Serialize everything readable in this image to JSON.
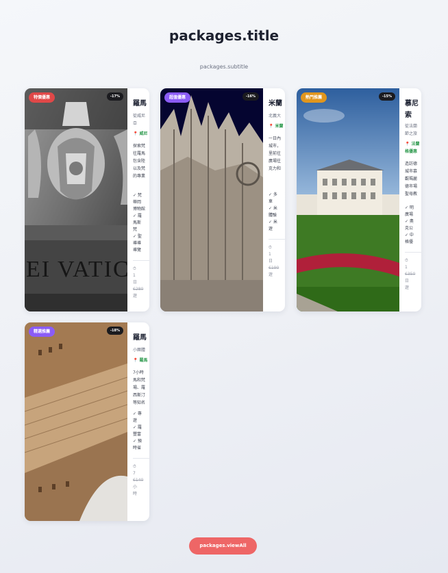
{
  "header": {
    "title": "packages.title",
    "subtitle": "packages.subtitle"
  },
  "cards": [
    {
      "tag": "特價優惠",
      "tag_color": "#e04848",
      "discount": "-17%",
      "name": "羅馬",
      "sub1": "從威尼",
      "sub2": "亞",
      "location": "威尼",
      "desc": [
        "探索梵",
        "往羅馬",
        "包含陸",
        "以及梵",
        "的專業"
      ],
      "features": [
        "✓ 梵",
        "蒂岡",
        "博物館",
        "✓ 羅",
        "馬斯",
        "梵",
        "✓ 聖",
        "導導",
        "導覽"
      ],
      "duration_icon": "⏱",
      "duration": "1",
      "duration_unit": "日",
      "old_price": "€280",
      "price_label": "遊"
    },
    {
      "tag": "超值優惠",
      "tag_color": "#8b5cf6",
      "discount": "-16%",
      "name": "米蘭",
      "sub1": "北義大",
      "location": "米蘭",
      "desc": [
        "一日內",
        "城市，",
        "里前往",
        "廣場往",
        "克力和"
      ],
      "features": [
        "✓ 多",
        "車",
        "✓ 米",
        "體驗",
        "✓ 米",
        "遊"
      ],
      "duration_icon": "⏱",
      "duration": "1",
      "duration_unit": "日",
      "old_price": "€190",
      "price_label": "遊"
    },
    {
      "tag": "熱門推薦",
      "tag_color": "#e0961e",
      "discount": "-15%",
      "name": "慕尼",
      "name_line2": "索",
      "sub1": "從法蘭",
      "sub2": "節之旅",
      "location": "法蘭",
      "location2": "格優惠",
      "desc": [
        "造訪德",
        "城市慕",
        "觀瑪麗",
        "德市場",
        "聖母教"
      ],
      "features": [
        "✓ 明",
        "廣場",
        "✓ 奧",
        "克公",
        "✓ 中",
        "格優"
      ],
      "duration_icon": "⏱",
      "duration": "1",
      "duration_unit": "日",
      "old_price": "€350",
      "price_label": "遊"
    },
    {
      "tag": "精選推薦",
      "tag_color": "#8b5cf6",
      "discount": "-18%",
      "name": "羅馬",
      "sub1": "小團體",
      "location": "羅馬",
      "desc": [
        "7小時",
        "馬和梵",
        "場、羅",
        "西斯汀",
        "等知名"
      ],
      "features": [
        "✓ 專",
        "遊",
        "✓ 羅",
        "豐富",
        "✓ 預",
        "時省"
      ],
      "duration_icon": "⏱",
      "duration": "7",
      "duration_unit": "小",
      "duration_unit2": "時",
      "old_price": "€140"
    }
  ],
  "footer": {
    "view_all": "packages.viewAll"
  }
}
